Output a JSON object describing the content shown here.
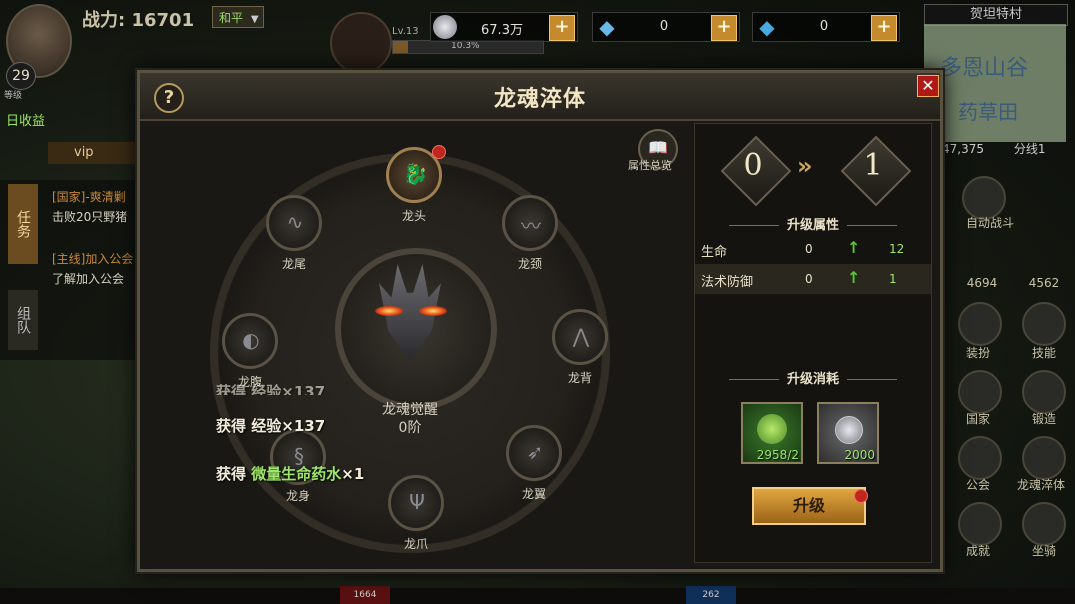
{
  "hud": {
    "power_label": "战力:",
    "power_value": "16701",
    "mode": "和平",
    "level": "29",
    "level_caption": "等级",
    "pet_level": "Lv.13",
    "pet_exp": "10.3%",
    "currencies": [
      {
        "icon": "coin-icon",
        "value": "67.3万",
        "color": "#c0c0c8"
      },
      {
        "icon": "bound-diamond-icon",
        "value": "0",
        "color": "#6ab8e8"
      },
      {
        "icon": "diamond-icon",
        "value": "0",
        "color": "#4aa8e0"
      }
    ],
    "plus_glyph": "+"
  },
  "minimap": {
    "name": "贺坦特村",
    "label1": "多恩山谷",
    "label2": "药草田",
    "coords": "47,375",
    "line": "分线1"
  },
  "left_panel": {
    "daily": "日收益",
    "vip": "vip",
    "tab_task": "任务",
    "tab_team": "组队",
    "quests": [
      "[国家]-爽清剿",
      "击败20只野猪",
      "[主线]加入公会",
      "了解加入公会"
    ]
  },
  "right_menu": {
    "auto_battle": "自动战斗",
    "hp1": "4694",
    "hp2": "4562",
    "items": [
      "装扮",
      "技能",
      "国家",
      "锻造",
      "公会",
      "龙魂淬体",
      "成就",
      "坐骑"
    ]
  },
  "dialog": {
    "title": "龙魂淬体",
    "help_glyph": "?",
    "close_glyph": "✕",
    "overview_label": "属性总览",
    "core_name": "龙魂觉醒",
    "core_stage": "0阶",
    "parts": [
      "龙头",
      "龙颈",
      "龙背",
      "龙翼",
      "龙爪",
      "龙身",
      "龙腹",
      "龙尾"
    ],
    "loot": [
      {
        "prefix": "获得",
        "text": "经验×137",
        "green": false
      },
      {
        "prefix": "获得",
        "text": "经验×137",
        "green": false
      },
      {
        "prefix": "获得",
        "text": "微量生命药水",
        "suffix": "×1",
        "green": true
      }
    ],
    "level_from": "0",
    "level_to": "1",
    "upgrade_attr_title": "升级属性",
    "attrs": [
      {
        "name": "生命",
        "from": "0",
        "to": "12"
      },
      {
        "name": "法术防御",
        "from": "0",
        "to": "1"
      }
    ],
    "cost_title": "升级消耗",
    "costs": [
      {
        "icon": "herb-icon",
        "qty": "2958/2"
      },
      {
        "icon": "coin-icon",
        "qty": "2000"
      }
    ],
    "upgrade_button": "升级"
  },
  "bottom": {
    "left": "1664",
    "right": "262"
  }
}
